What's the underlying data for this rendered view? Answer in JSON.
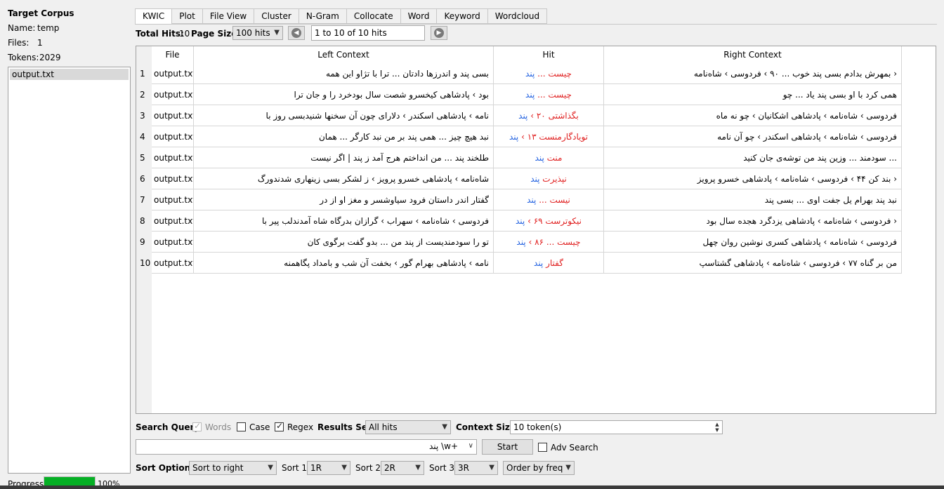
{
  "left_panel": {
    "title": "Target Corpus",
    "name_label": "Name:",
    "name_value": "temp",
    "files_label": "Files:",
    "files_value": "1",
    "tokens_label": "Tokens:",
    "tokens_value": "2029",
    "files": [
      "output.txt"
    ],
    "progress_label": "Progress",
    "progress_value": "100%",
    "progress_fraction": 1.0
  },
  "tabs": [
    "KWIC",
    "Plot",
    "File View",
    "Cluster",
    "N-Gram",
    "Collocate",
    "Word",
    "Keyword",
    "Wordcloud"
  ],
  "active_tab": "KWIC",
  "hits_bar": {
    "total_hits_label": "Total Hits:",
    "total_hits_value": "10",
    "page_size_label": "Page Size",
    "page_size_value": "100 hits",
    "range_text": "1 to 10 of 10 hits",
    "prev_icon": "arrow-left-icon",
    "next_icon": "arrow-right-icon"
  },
  "table": {
    "headers": [
      "File",
      "Left Context",
      "Hit",
      "Right Context"
    ],
    "rows": [
      {
        "n": "1",
        "file": "output.txt",
        "left": "بسی پند و اندرزها دادتان ... ترا با تژاو این همه",
        "hit_a": "پند",
        "hit_b": "چیست ...",
        "right_plain": "بمهرش بدادم بسی پند خوب ... ۹۰ › فردوسی › شاه‌نامه ›",
        "right_color": ""
      },
      {
        "n": "2",
        "file": "output.txt",
        "left": "بود › پادشاهی کیخسرو شصت سال بودخرد را و جان ترا",
        "hit_a": "پند",
        "hit_b": "چیست ...",
        "right_plain": "همی کرد با او بسی پند یاد ... چو",
        "right_color": ""
      },
      {
        "n": "3",
        "file": "output.txt",
        "left": "نامه › پادشاهی اسکندر › دلارای چون آن سخنها شنیدبسی روز با",
        "hit_a": "پند",
        "hit_b": "بگذاشتی ۲۰ ›",
        "right_plain": "فردوسی › شاه‌نامه › پادشاهی اشکانیان › چو نه ماه",
        "right_color": ""
      },
      {
        "n": "4",
        "file": "output.txt",
        "left": "نبد هیچ چیز ... همی پند بر من نبد کارگر ... همان",
        "hit_a": "پند",
        "hit_b": "تویادگارمنست ۱۳ ›",
        "right_plain": "فردوسی › شاه‌نامه › پادشاهی اسکندر › چو آن نامه",
        "right_color": ""
      },
      {
        "n": "5",
        "file": "output.txt",
        "left": "طلخند پند ... من انداختم هرج آمد ز پند | اگر نیست",
        "hit_a": "پند",
        "hit_b": "منت",
        "right_plain": "سودمند ... وزین پند من توشه‌ی جان کنید ...",
        "right_color": ""
      },
      {
        "n": "6",
        "file": "output.txt",
        "left": "شاه‌نامه › پادشاهی خسرو پرویز › ز لشکر بسی زینهاری شدندورگ",
        "hit_a": "پند",
        "hit_b": "نپذیرت",
        "right_plain": "بند کن ۴۴ › فردوسی › شاه‌نامه › پادشاهی خسرو پرویز ›",
        "right_color": ""
      },
      {
        "n": "7",
        "file": "output.txt",
        "left": "گفتار اندر داستان فرود سیاوشسر و مغز او از در",
        "hit_a": "پند",
        "hit_b": "نیست ...",
        "right_plain": "نبد پند بهرام یل جفت اوی ... بسی پند",
        "right_color": ""
      },
      {
        "n": "8",
        "file": "output.txt",
        "left": "فردوسی › شاه‌نامه › سهراب › گرازان بدرگاه شاه آمدندلب پیر با",
        "hit_a": "پند",
        "hit_b": "نیکوترست ۶۹ ›",
        "right_plain": "فردوسی › شاه‌نامه › پادشاهی یزدگرد هجده سال بود ›",
        "right_color": ""
      },
      {
        "n": "9",
        "file": "output.txt",
        "left": "تو را سودمندیست از پند من ... بدو گفت برگوی کان",
        "hit_a": "پند",
        "hit_b": "چیست ... ۸۶ ›",
        "right_plain": "فردوسی › شاه‌نامه › پادشاهی کسری نوشین روان چهل",
        "right_color": ""
      },
      {
        "n": "10",
        "file": "output.txt",
        "left": "نامه › پادشاهی بهرام گور › بخفت آن شب و بامداد پگاهمنه",
        "hit_a": "پند",
        "hit_b": "گفتار",
        "right_plain": "من بر گناه ۷۷ › فردوسی › شاه‌نامه › پادشاهی گشتاسپ",
        "right_color": ""
      }
    ]
  },
  "search": {
    "query_label": "Search Query",
    "words_label": "Words",
    "words_checked": true,
    "case_label": "Case",
    "case_checked": false,
    "regex_label": "Regex",
    "regex_checked": true,
    "results_set_label": "Results Set",
    "results_set_value": "All hits",
    "context_size_label": "Context Size",
    "context_size_value": "10 token(s)",
    "query_value": "پند \\w+",
    "start_label": "Start",
    "adv_search_label": "Adv Search",
    "adv_search_checked": false
  },
  "sort": {
    "label": "Sort Options",
    "value": "Sort to right",
    "sort1_label": "Sort 1",
    "sort1_value": "1R",
    "sort2_label": "Sort 2",
    "sort2_value": "2R",
    "sort3_label": "Sort 3",
    "sort3_value": "3R",
    "order_value": "Order by freq"
  },
  "colors": {
    "hit_red": "#e02020",
    "hit_blue": "#2060e0",
    "green": "#1aa31a",
    "progress": "#06b025"
  }
}
